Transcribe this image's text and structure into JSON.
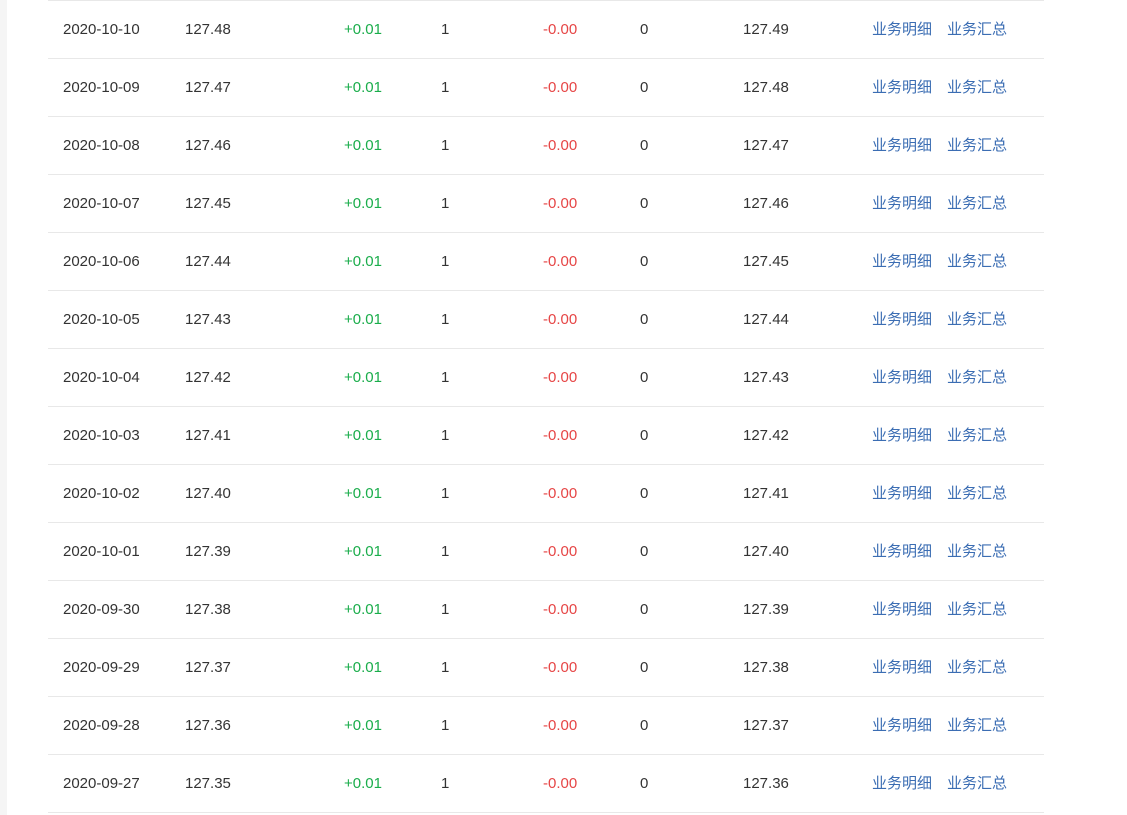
{
  "colors": {
    "positive": "#1aad4b",
    "negative": "#e64545",
    "link": "#3b6db3",
    "border": "#e8e8e8"
  },
  "table": {
    "rows": [
      {
        "date": "2020-10-10",
        "a": "127.48",
        "inc": "+0.01",
        "n1": "1",
        "dec": "-0.00",
        "n2": "0",
        "b": "127.49",
        "detail_label": "业务明细",
        "summary_label": "业务汇总"
      },
      {
        "date": "2020-10-09",
        "a": "127.47",
        "inc": "+0.01",
        "n1": "1",
        "dec": "-0.00",
        "n2": "0",
        "b": "127.48",
        "detail_label": "业务明细",
        "summary_label": "业务汇总"
      },
      {
        "date": "2020-10-08",
        "a": "127.46",
        "inc": "+0.01",
        "n1": "1",
        "dec": "-0.00",
        "n2": "0",
        "b": "127.47",
        "detail_label": "业务明细",
        "summary_label": "业务汇总"
      },
      {
        "date": "2020-10-07",
        "a": "127.45",
        "inc": "+0.01",
        "n1": "1",
        "dec": "-0.00",
        "n2": "0",
        "b": "127.46",
        "detail_label": "业务明细",
        "summary_label": "业务汇总"
      },
      {
        "date": "2020-10-06",
        "a": "127.44",
        "inc": "+0.01",
        "n1": "1",
        "dec": "-0.00",
        "n2": "0",
        "b": "127.45",
        "detail_label": "业务明细",
        "summary_label": "业务汇总"
      },
      {
        "date": "2020-10-05",
        "a": "127.43",
        "inc": "+0.01",
        "n1": "1",
        "dec": "-0.00",
        "n2": "0",
        "b": "127.44",
        "detail_label": "业务明细",
        "summary_label": "业务汇总"
      },
      {
        "date": "2020-10-04",
        "a": "127.42",
        "inc": "+0.01",
        "n1": "1",
        "dec": "-0.00",
        "n2": "0",
        "b": "127.43",
        "detail_label": "业务明细",
        "summary_label": "业务汇总"
      },
      {
        "date": "2020-10-03",
        "a": "127.41",
        "inc": "+0.01",
        "n1": "1",
        "dec": "-0.00",
        "n2": "0",
        "b": "127.42",
        "detail_label": "业务明细",
        "summary_label": "业务汇总"
      },
      {
        "date": "2020-10-02",
        "a": "127.40",
        "inc": "+0.01",
        "n1": "1",
        "dec": "-0.00",
        "n2": "0",
        "b": "127.41",
        "detail_label": "业务明细",
        "summary_label": "业务汇总"
      },
      {
        "date": "2020-10-01",
        "a": "127.39",
        "inc": "+0.01",
        "n1": "1",
        "dec": "-0.00",
        "n2": "0",
        "b": "127.40",
        "detail_label": "业务明细",
        "summary_label": "业务汇总"
      },
      {
        "date": "2020-09-30",
        "a": "127.38",
        "inc": "+0.01",
        "n1": "1",
        "dec": "-0.00",
        "n2": "0",
        "b": "127.39",
        "detail_label": "业务明细",
        "summary_label": "业务汇总"
      },
      {
        "date": "2020-09-29",
        "a": "127.37",
        "inc": "+0.01",
        "n1": "1",
        "dec": "-0.00",
        "n2": "0",
        "b": "127.38",
        "detail_label": "业务明细",
        "summary_label": "业务汇总"
      },
      {
        "date": "2020-09-28",
        "a": "127.36",
        "inc": "+0.01",
        "n1": "1",
        "dec": "-0.00",
        "n2": "0",
        "b": "127.37",
        "detail_label": "业务明细",
        "summary_label": "业务汇总"
      },
      {
        "date": "2020-09-27",
        "a": "127.35",
        "inc": "+0.01",
        "n1": "1",
        "dec": "-0.00",
        "n2": "0",
        "b": "127.36",
        "detail_label": "业务明细",
        "summary_label": "业务汇总"
      }
    ]
  }
}
